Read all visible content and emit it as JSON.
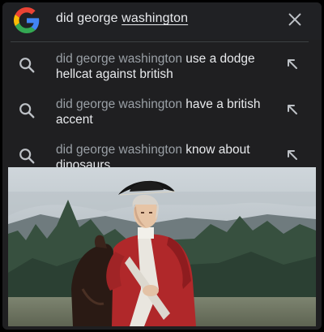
{
  "search": {
    "query_prefix": "did george ",
    "query_underlined": "washington",
    "logo_icon": "google-g-icon",
    "clear_icon": "close-icon"
  },
  "suggestions": [
    {
      "prefix": "did george washington",
      "completion": "use a dodge hellcat against british",
      "icon": "search-icon",
      "action_icon": "arrow-up-left-icon"
    },
    {
      "prefix": "did george washington",
      "completion": "have a british accent",
      "icon": "search-icon",
      "action_icon": "arrow-up-left-icon"
    },
    {
      "prefix": "did george washington",
      "completion": "know about dinosaurs",
      "icon": "search-icon",
      "action_icon": "arrow-up-left-icon"
    }
  ],
  "colors": {
    "background": "#202124",
    "text_primary": "#e8eaed",
    "text_secondary": "#9aa0a6",
    "redcoat": "#b0282a"
  }
}
